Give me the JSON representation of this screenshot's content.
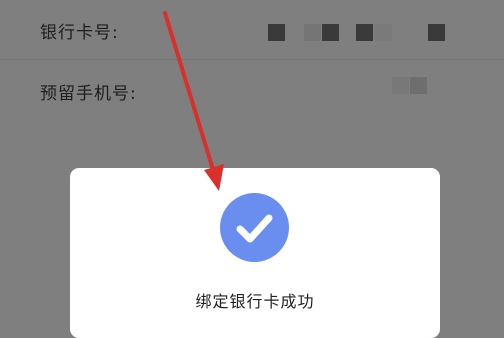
{
  "form": {
    "card_label": "银行卡号:",
    "phone_label": "预留手机号:"
  },
  "dialog": {
    "icon": "check-circle-icon",
    "message": "绑定银行卡成功"
  },
  "colors": {
    "overlay": "#7f7f7f",
    "accent": "#6a8df0",
    "annotation_arrow": "#d9302b"
  },
  "watermark": "xxxx",
  "annotation": "arrow pointing to success icon"
}
